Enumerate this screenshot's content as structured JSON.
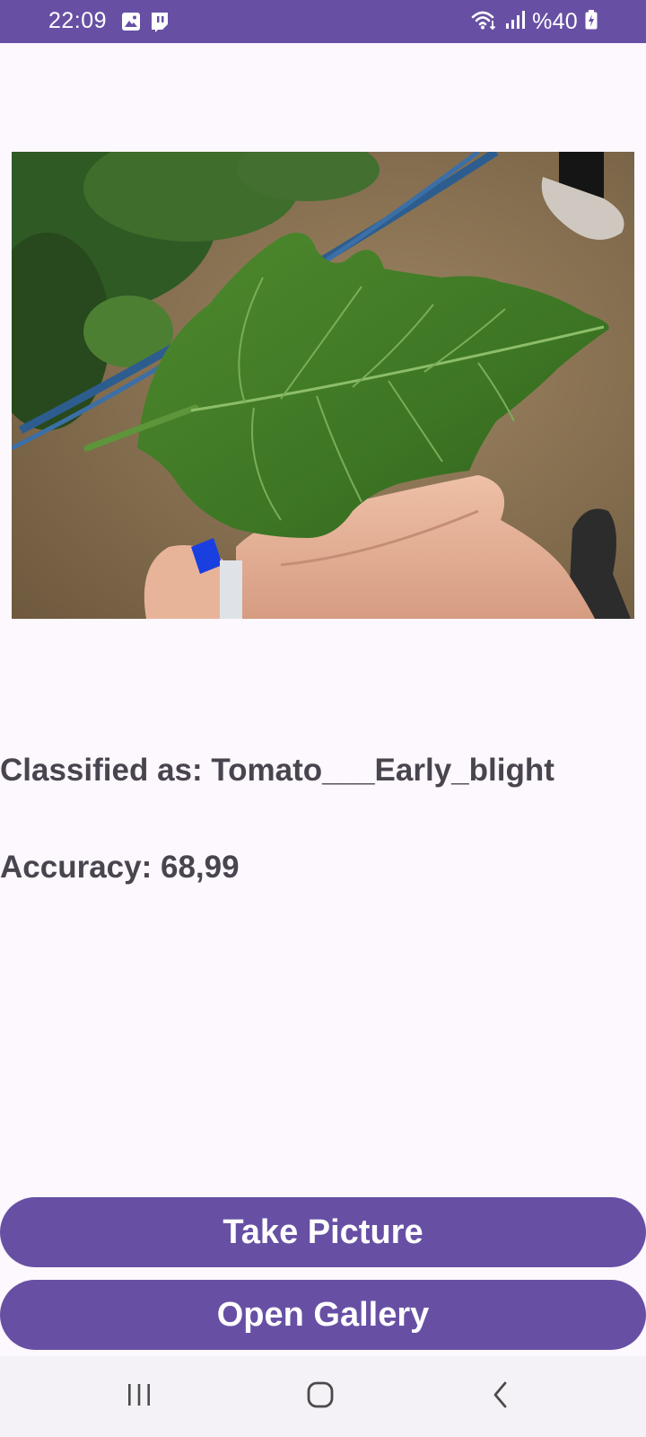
{
  "status_bar": {
    "time": "22:09",
    "battery": "%40",
    "icons": [
      "gallery-notification-icon",
      "twitch-notification-icon",
      "wifi-icon",
      "signal-icon",
      "battery-charging-icon"
    ]
  },
  "image": {
    "subject": "tomato-leaf-photo"
  },
  "result": {
    "classified_label": "Classified as: Tomato___Early_blight",
    "accuracy_label": "Accuracy: 68,99"
  },
  "buttons": {
    "take_picture": "Take Picture",
    "open_gallery": "Open Gallery"
  },
  "nav_bar": {
    "icons": [
      "recents-icon",
      "home-icon",
      "back-icon"
    ]
  },
  "colors": {
    "primary": "#6750a4",
    "background": "#fdf7fe",
    "text": "#49454f",
    "nav_background": "#f4f2f6"
  }
}
